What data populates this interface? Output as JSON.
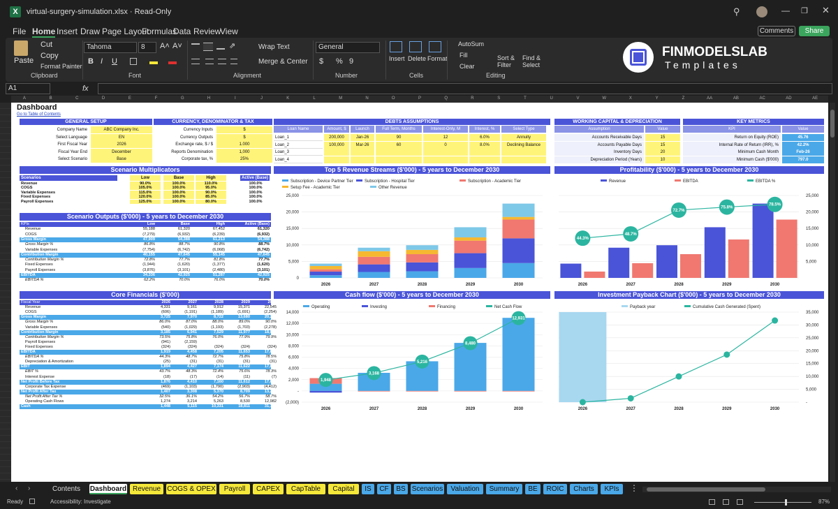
{
  "window": {
    "title": "virtual-surgery-simulation.xlsx  ·  Read-Only"
  },
  "menu": [
    "File",
    "Home",
    "Insert",
    "Draw",
    "Page Layout",
    "Formulas",
    "Data",
    "Review",
    "View"
  ],
  "actions": {
    "comments": "Comments",
    "share": "Share"
  },
  "ribbon": {
    "paste": "Paste",
    "cut": "Cut",
    "copy": "Copy",
    "format_painter": "Format Painter",
    "clipboard": "Clipboard",
    "font_name": "Tahoma",
    "font_size": "8",
    "font": "Font",
    "alignment": "Alignment",
    "wrap_text": "Wrap Text",
    "merge_center": "Merge & Center",
    "number_format": "General",
    "number": "Number",
    "insert": "Insert",
    "delete": "Delete",
    "format": "Format",
    "cells": "Cells",
    "autosum": "AutoSum",
    "fill": "Fill",
    "clear": "Clear",
    "sort_filter": "Sort & Filter",
    "find_select": "Find & Select",
    "editing": "Editing"
  },
  "brand": {
    "name": "FINMODELSLAB",
    "sub": "Templates"
  },
  "formula_bar": {
    "cell_ref": "A1",
    "fx": "fx"
  },
  "columns": [
    "A",
    "B",
    "C",
    "D",
    "E",
    "F",
    "G",
    "H",
    "I",
    "J",
    "K",
    "L",
    "M",
    "N",
    "O",
    "P",
    "Q",
    "R",
    "S",
    "T",
    "U",
    "V",
    "W",
    "X",
    "Y",
    "Z",
    "AA",
    "AB",
    "AC",
    "AD",
    "AE"
  ],
  "sheet": {
    "title": "Dashboard",
    "link": "Go to Table of Contents",
    "general_setup": {
      "header": "GENERAL SETUP",
      "rows": [
        [
          "Company Name",
          "ABC Company Inc."
        ],
        [
          "Select Language",
          "EN"
        ],
        [
          "First Fiscal Year",
          "2026"
        ],
        [
          "Fiscal Year End",
          "December"
        ],
        [
          "Select Scenario",
          "Base"
        ]
      ]
    },
    "currency": {
      "header": "CURRENCY, DENOMINATOR & TAX",
      "rows": [
        [
          "Currency Inputs",
          "$"
        ],
        [
          "Currency Outputs",
          "$"
        ],
        [
          "Exchange rate, $ / $",
          "1.000"
        ],
        [
          "Reports Denomination",
          "1,000"
        ],
        [
          "Corporate tax, %",
          "25%"
        ]
      ]
    },
    "debts": {
      "header": "DEBTS ASSUMPTIONS",
      "cols": [
        "Loan Name",
        "Amount, $",
        "Launch",
        "Full Term, Months",
        "Interest-Only, M",
        "Interest, %",
        "Select Type"
      ],
      "rows": [
        [
          "Loan_1",
          "200,000",
          "Jan-26",
          "90",
          "12",
          "6.0%",
          "Annuity"
        ],
        [
          "Loan_2",
          "100,000",
          "Mar-26",
          "60",
          "0",
          "8.0%",
          "Declining Balance"
        ],
        [
          "Loan_3",
          "",
          "",
          "",
          "",
          "",
          ""
        ],
        [
          "Loan_4",
          "",
          "",
          "",
          "",
          "",
          ""
        ]
      ]
    },
    "working_capital": {
      "header": "WORKING CAPITAL & DEPRECIATION",
      "cols": [
        "Assumption",
        "Value"
      ],
      "rows": [
        [
          "Accounts Receivable Days",
          "15"
        ],
        [
          "Accounts Payable Days",
          "15"
        ],
        [
          "Inventory Days",
          "20"
        ],
        [
          "Depreciation Period (Years)",
          "10"
        ]
      ]
    },
    "key_metrics": {
      "header": "KEY METRICS",
      "cols": [
        "KPI",
        "Value"
      ],
      "rows": [
        [
          "Return on Equity (ROE)",
          "45.76"
        ],
        [
          "Internal Rate of Return (IRR), %",
          "42.2%"
        ],
        [
          "Minimum Cash Month",
          "Feb-26"
        ],
        [
          "Minimum Cash ($'000)",
          "797.0"
        ]
      ]
    },
    "scenario_mult": {
      "header": "Scenario Multiplicators",
      "cols": [
        "Scenarios",
        "Low",
        "Base",
        "High",
        "Active (Base)"
      ],
      "rows": [
        [
          "Revenue",
          "90.0%",
          "100.0%",
          "110.0%",
          "100.0%"
        ],
        [
          "COGS",
          "105.0%",
          "100.0%",
          "95.0%",
          "100.0%"
        ],
        [
          "Variable Expenses",
          "115.0%",
          "100.0%",
          "90.0%",
          "100.0%"
        ],
        [
          "Fixed Expenses",
          "120.0%",
          "100.0%",
          "85.0%",
          "100.0%"
        ],
        [
          "Payroll Expenses",
          "125.0%",
          "100.0%",
          "80.0%",
          "100.0%"
        ]
      ]
    },
    "scenario_out": {
      "header": "Scenario Outputs ($'000) - 5 years to December 2030",
      "cols": [
        "KPIs",
        "Low",
        "Base",
        "High",
        "Active (Base)"
      ],
      "rows": [
        [
          "Revenue",
          "55,188",
          "61,320",
          "67,452",
          "61,320",
          ""
        ],
        [
          "COGS",
          "(7,279)",
          "(6,932)",
          "(6,239)",
          "(6,932)",
          ""
        ],
        [
          "Gross Margin",
          "47,909",
          "54,388",
          "61,213",
          "54,388",
          "hl"
        ],
        [
          "Gross Margin %",
          "86.8%",
          "88.7%",
          "90.8%",
          "88.7%",
          "it"
        ],
        [
          "Variable Expenses",
          "(7,754)",
          "(6,742)",
          "(6,068)",
          "(6,742)",
          ""
        ],
        [
          "Contribution Margin",
          "40,155",
          "47,645",
          "55,145",
          "47,645",
          "hl"
        ],
        [
          "Contribution Margin %",
          "72.8%",
          "77.7%",
          "81.8%",
          "77.7%",
          "it"
        ],
        [
          "Fixed Expenses",
          "(1,944)",
          "(1,620)",
          "(1,377)",
          "(1,620)",
          ""
        ],
        [
          "Payroll Expenses",
          "(3,876)",
          "(3,101)",
          "(2,480)",
          "(3,101)",
          ""
        ],
        [
          "EBITDA",
          "34,336",
          "42,925",
          "51,287",
          "42,925",
          "hl"
        ],
        [
          "EBITDA %",
          "62.2%",
          "70.0%",
          "76.0%",
          "70.0%",
          "it"
        ]
      ]
    },
    "core": {
      "header": "Core Financials ($'000)",
      "cols": [
        "Fiscal Year",
        "2026",
        "2027",
        "2028",
        "2029",
        "2030"
      ],
      "rows": [
        [
          "Revenue",
          "4,331",
          "9,161",
          "9,912",
          "15,371",
          "22,545",
          ""
        ],
        [
          "COGS",
          "(606)",
          "(1,191)",
          "(1,189)",
          "(1,691)",
          "(2,254)",
          ""
        ],
        [
          "Gross Margin",
          "3,725",
          "7,970",
          "8,722",
          "13,680",
          "20,290",
          "hl"
        ],
        [
          "Gross Margin %",
          "86.0%",
          "87.0%",
          "88.0%",
          "89.0%",
          "90.0%",
          "it"
        ],
        [
          "Variable Expenses",
          "(540)",
          "(1,029)",
          "(1,193)",
          "(1,703)",
          "(2,278)",
          ""
        ],
        [
          "Contribution Margin",
          "3,185",
          "6,941",
          "7,529",
          "11,977",
          "18,013",
          "hl"
        ],
        [
          "Contribution Margin %",
          "73.5%",
          "75.8%",
          "76.0%",
          "77.9%",
          "79.9%",
          "it"
        ],
        [
          "Payroll Expenses",
          "(941)",
          "(2,159)",
          "",
          "",
          ""
        ],
        [
          "Fixed Expenses",
          "(324)",
          "(324)",
          "(324)",
          "(324)",
          "(324)",
          ""
        ],
        [
          "EBITDA",
          "1,919",
          "4,458",
          "7,205",
          "11,653",
          "17,688",
          "hl"
        ],
        [
          "EBITDA %",
          "44.3%",
          "48.7%",
          "72.7%",
          "75.8%",
          "78.5%",
          "it"
        ],
        [
          "Depreciation & Amortization",
          "(25)",
          "(31)",
          "(31)",
          "(31)",
          "(31)",
          ""
        ],
        [
          "EBIT",
          "1,894",
          "4,427",
          "7,174",
          "11,622",
          "17,657",
          "hl"
        ],
        [
          "EBIT %",
          "43.7%",
          "48.3%",
          "72.4%",
          "75.6%",
          "78.3%",
          "it"
        ],
        [
          "Interest Expense",
          "(18)",
          "(17)",
          "(14)",
          "(11)",
          "(7)",
          ""
        ],
        [
          "Net Profit Before Tax",
          "1,876",
          "4,410",
          "7,160",
          "11,612",
          "17,650",
          "hl"
        ],
        [
          "Corporate Tax Expense",
          "(469)",
          "(1,103)",
          "(1,790)",
          "(2,903)",
          "(4,412)",
          ""
        ],
        [
          "Net Profit After Tax",
          "1,407",
          "3,308",
          "5,370",
          "8,709",
          "13,237",
          "hl"
        ],
        [
          "Net Profit After Tax %",
          "32.5%",
          "36.1%",
          "54.2%",
          "56.7%",
          "58.7%",
          "it"
        ],
        [
          "Operating Cash Flows",
          "1,274",
          "3,214",
          "5,263",
          "8,530",
          "12,982",
          ""
        ],
        [
          "Cash",
          "1,448",
          "5,115",
          "10,331",
          "18,811",
          "31,742",
          "hl"
        ]
      ]
    }
  },
  "chart_data": [
    {
      "type": "bar",
      "title": "Top 5 Revenue Streams ($'000) - 5 years to December 2030",
      "categories": [
        "2026",
        "2027",
        "2028",
        "2029",
        "2030"
      ],
      "series": [
        {
          "name": "Subscription - Device Partner Tier",
          "color": "#4aa8e8",
          "values": [
            800,
            1800,
            2000,
            3000,
            4500
          ]
        },
        {
          "name": "Subscription - Hospital Tier",
          "color": "#4a54d8",
          "values": [
            1100,
            2300,
            2700,
            4500,
            7500
          ]
        },
        {
          "name": "Subscription - Academic Tier",
          "color": "#f07870",
          "values": [
            700,
            2300,
            2500,
            3800,
            5700
          ]
        },
        {
          "name": "Setup Fee - Academic Tier",
          "color": "#f6b830",
          "values": [
            1000,
            1700,
            1300,
            1000,
            800
          ]
        },
        {
          "name": "Other Revenue",
          "color": "#7ec8e8",
          "values": [
            731,
            1061,
            1412,
            3071,
            4045
          ]
        }
      ],
      "ylim": [
        0,
        25000
      ],
      "yticks": [
        "0",
        "5,000",
        "10,000",
        "15,000",
        "20,000",
        "25,000"
      ]
    },
    {
      "type": "bar",
      "title": "Profitability ($'000) - 5 years to December 2030",
      "categories": [
        "2026",
        "2027",
        "2028",
        "2029",
        "2030"
      ],
      "series": [
        {
          "name": "Revenue",
          "color": "#4a54d8",
          "values": [
            4331,
            9161,
            9912,
            15371,
            22545
          ]
        },
        {
          "name": "EBITDA",
          "color": "#f07870",
          "values": [
            1919,
            4458,
            7205,
            11653,
            17688
          ]
        },
        {
          "name": "EBITDA %",
          "color": "#2bb5a0",
          "values": [
            44.3,
            48.7,
            72.7,
            75.8,
            78.5
          ],
          "labels": [
            "44.3%",
            "48.7%",
            "72.7%",
            "75.8%",
            "78.5%"
          ]
        }
      ],
      "ylim": [
        0,
        25000
      ],
      "yticks": [
        "5,000",
        "10,000",
        "15,000",
        "20,000",
        "25,000"
      ]
    },
    {
      "type": "bar",
      "title": "Cash flow ($'000) - 5 years to December 2030",
      "categories": [
        "2026",
        "2027",
        "2028",
        "2029",
        "2030"
      ],
      "series": [
        {
          "name": "Operating",
          "color": "#4aa8e8",
          "values": [
            1274,
            3214,
            5263,
            8530,
            12982
          ]
        },
        {
          "name": "Investing",
          "color": "#4a54d8",
          "values": [
            -300,
            0,
            0,
            0,
            0
          ]
        },
        {
          "name": "Financing",
          "color": "#f07870",
          "values": [
            1000,
            -60,
            -50,
            -50,
            -50
          ]
        },
        {
          "name": "Net Cash Flow",
          "color": "#2bb5a0",
          "values": [
            1948,
            3168,
            5216,
            8480,
            12931
          ],
          "labels": [
            "1,948",
            "3,168",
            "5,216",
            "8,480",
            "12,931"
          ]
        }
      ],
      "ylim": [
        -2000,
        14000
      ],
      "yticks": [
        "(2,000)",
        "-",
        "2,000",
        "4,000",
        "6,000",
        "8,000",
        "10,000",
        "12,000",
        "14,000"
      ]
    },
    {
      "type": "line",
      "title": "Investment Payback Chart ($'000) - 5 years to December 2030",
      "categories": [
        "2026",
        "2027",
        "2028",
        "2029",
        "2030"
      ],
      "series": [
        {
          "name": "Payback year",
          "color": "#a8d8f0",
          "values": [
            1,
            0,
            0,
            0,
            0
          ]
        },
        {
          "name": "Cumulative Cash Generated (Spent)",
          "color": "#2bb5a0",
          "values": [
            0,
            1500,
            10000,
            18500,
            31742
          ]
        }
      ],
      "ylim": [
        0,
        35000
      ],
      "yticks": [
        "-",
        "5,000",
        "10,000",
        "15,000",
        "20,000",
        "25,000",
        "30,000",
        "35,000"
      ]
    }
  ],
  "tabs": [
    {
      "label": "Contents",
      "color": "#1f1f1f",
      "text": "#ddd"
    },
    {
      "label": "Dashboard",
      "color": "#ffffff",
      "text": "#111"
    },
    {
      "label": "Revenue",
      "color": "#f6e83a",
      "text": "#111"
    },
    {
      "label": "COGS & OPEX",
      "color": "#f6e83a",
      "text": "#111"
    },
    {
      "label": "Payroll",
      "color": "#f6e83a",
      "text": "#111"
    },
    {
      "label": "CAPEX",
      "color": "#f6e83a",
      "text": "#111"
    },
    {
      "label": "CapTable",
      "color": "#f6e83a",
      "text": "#111"
    },
    {
      "label": "Capital",
      "color": "#f6e83a",
      "text": "#111"
    },
    {
      "label": "IS",
      "color": "#4aa8e8",
      "text": "#111"
    },
    {
      "label": "CF",
      "color": "#4aa8e8",
      "text": "#111"
    },
    {
      "label": "BS",
      "color": "#4aa8e8",
      "text": "#111"
    },
    {
      "label": "Scenarios",
      "color": "#4aa8e8",
      "text": "#111"
    },
    {
      "label": "Valuation",
      "color": "#4aa8e8",
      "text": "#111"
    },
    {
      "label": "Summary",
      "color": "#4aa8e8",
      "text": "#111"
    },
    {
      "label": "BE",
      "color": "#4aa8e8",
      "text": "#111"
    },
    {
      "label": "ROIC",
      "color": "#4aa8e8",
      "text": "#111"
    },
    {
      "label": "Charts",
      "color": "#4aa8e8",
      "text": "#111"
    },
    {
      "label": "KPIs",
      "color": "#4aa8e8",
      "text": "#111"
    }
  ],
  "status": {
    "ready": "Ready",
    "accessibility": "Accessibility: Investigate",
    "zoom": "87%"
  }
}
